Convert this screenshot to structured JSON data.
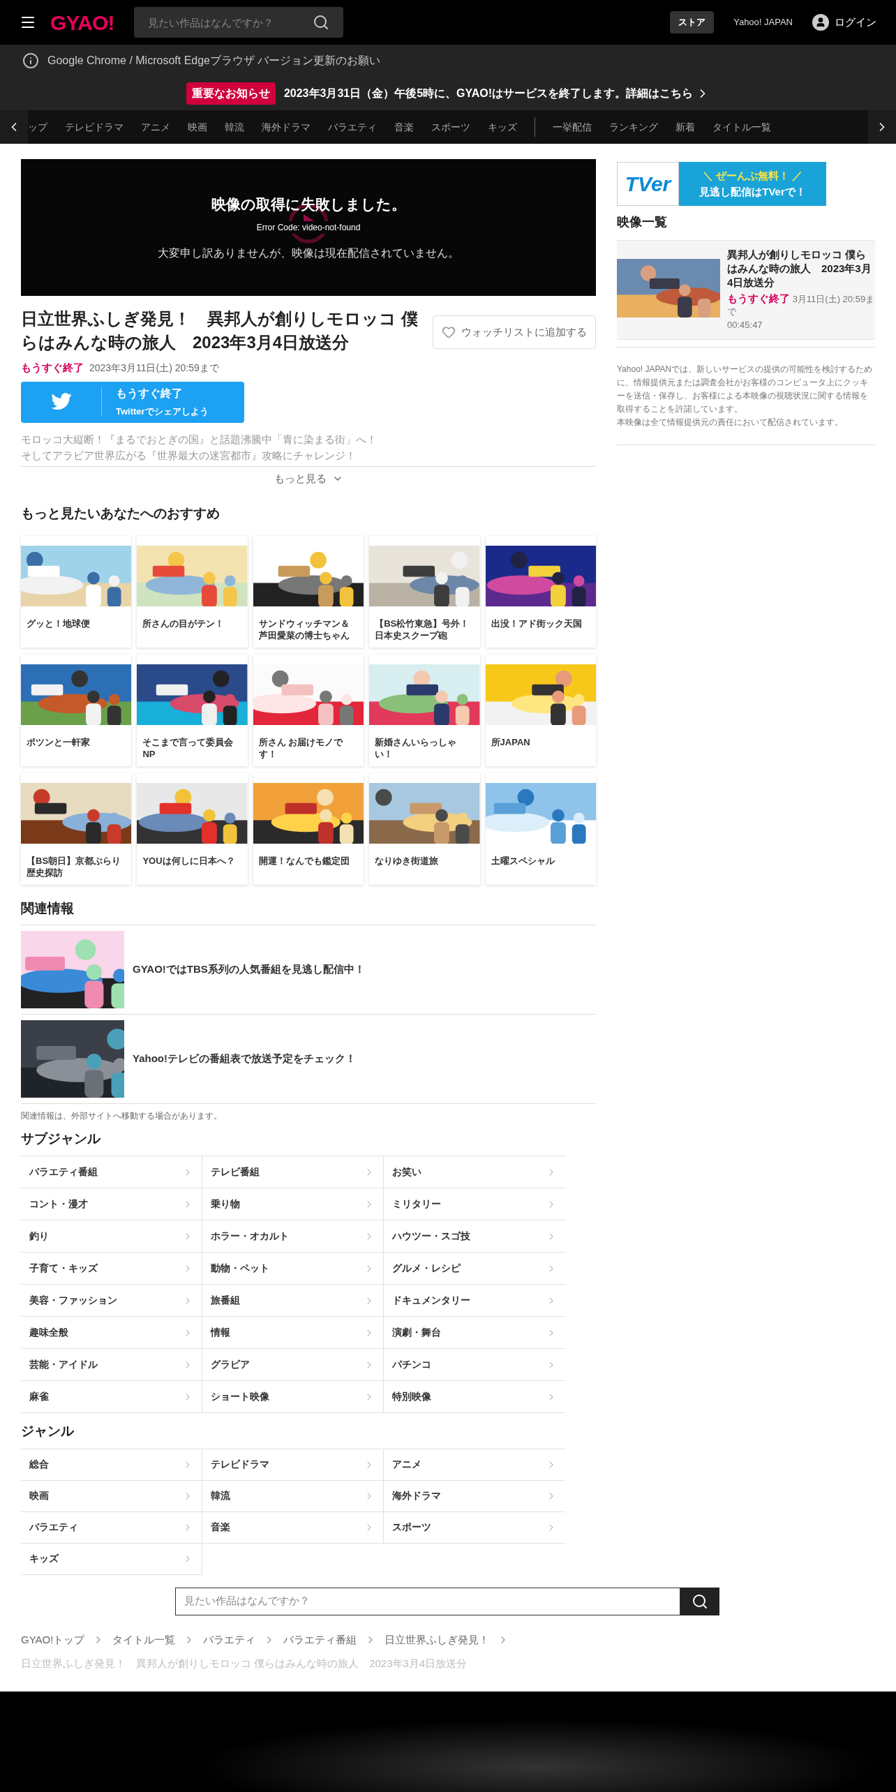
{
  "header": {
    "logo": "GYAO!",
    "search": {
      "placeholder": "見たい作品はなんですか？"
    },
    "store": "ストア",
    "yahoo": "Yahoo! JAPAN",
    "login": "ログイン"
  },
  "browser_notice": "Google Chrome / Microsoft Edgeブラウザ バージョン更新のお願い",
  "announcement": {
    "badge": "重要なお知らせ",
    "text": "2023年3月31日（金）午後5時に、GYAO!はサービスを終了します。詳細はこちら"
  },
  "nav": {
    "items": [
      "ップ",
      "テレビドラマ",
      "アニメ",
      "映画",
      "韓流",
      "海外ドラマ",
      "バラエティ",
      "音楽",
      "スポーツ",
      "キッズ"
    ],
    "extra_items": [
      "一挙配信",
      "ランキング",
      "新着",
      "タイトル一覧"
    ]
  },
  "player": {
    "error": "映像の取得に失敗しました。",
    "code": "Error Code: video-not-found",
    "message": "大変申し訳ありませんが、映像は現在配信されていません。"
  },
  "title": "日立世界ふしぎ発見！　異邦人が創りしモロッコ 僕らはみんな時の旅人　2023年3月4日放送分",
  "watchlist": "ウォッチリストに追加する",
  "status": {
    "badge": "もうすぐ終了",
    "until": "2023年3月11日(土) 20:59まで"
  },
  "twitter": {
    "line1": "もうすぐ終了",
    "line2": "Twitterでシェアしよう"
  },
  "description": [
    "モロッコ大縦断！『まるでおとぎの国』と話題沸騰中「青に染まる街」へ！",
    "そしてアラビア世界広がる『世界最大の迷宮都市』攻略にチャレンジ！"
  ],
  "more": "もっと見る",
  "recommend": {
    "heading": "もっと見たいあなたへのおすすめ",
    "items": [
      {
        "title": "グッと！地球便"
      },
      {
        "title": "所さんの目がテン！"
      },
      {
        "title": "サンドウィッチマン＆芦田愛菜の博士ちゃん"
      },
      {
        "title": "【BS松竹東急】号外！日本史スクープ砲"
      },
      {
        "title": "出没！アド街ック天国"
      },
      {
        "title": "ポツンと一軒家"
      },
      {
        "title": "そこまで言って委員会NP"
      },
      {
        "title": "所さん お届けモノです！"
      },
      {
        "title": "新婚さんいらっしゃい！"
      },
      {
        "title": "所JAPAN"
      },
      {
        "title": "【BS朝日】京都ぶらり歴史探訪"
      },
      {
        "title": "YOUは何しに日本へ？"
      },
      {
        "title": "開運！なんでも鑑定団"
      },
      {
        "title": "なりゆき街道旅"
      },
      {
        "title": "土曜スペシャル"
      }
    ]
  },
  "related": {
    "heading": "関連情報",
    "items": [
      {
        "text": "GYAO!ではTBS系列の人気番組を見逃し配信中！"
      },
      {
        "text": "Yahoo!テレビの番組表で放送予定をチェック！"
      }
    ],
    "note": "関連情報は、外部サイトへ移動する場合があります。"
  },
  "subgenres": {
    "heading": "サブジャンル",
    "items": [
      "バラエティ番組",
      "テレビ番組",
      "お笑い",
      "コント・漫才",
      "乗り物",
      "ミリタリー",
      "釣り",
      "ホラー・オカルト",
      "ハウツー・スゴ技",
      "子育て・キッズ",
      "動物・ペット",
      "グルメ・レシピ",
      "美容・ファッション",
      "旅番組",
      "ドキュメンタリー",
      "趣味全般",
      "情報",
      "演劇・舞台",
      "芸能・アイドル",
      "グラビア",
      "パチンコ",
      "麻雀",
      "ショート映像",
      "特別映像"
    ]
  },
  "genres": {
    "heading": "ジャンル",
    "items": [
      "総合",
      "テレビドラマ",
      "アニメ",
      "映画",
      "韓流",
      "海外ドラマ",
      "バラエティ",
      "音楽",
      "スポーツ",
      "キッズ"
    ]
  },
  "bottom_search": {
    "placeholder": "見たい作品はなんですか？"
  },
  "breadcrumb": [
    "GYAO!トップ",
    "タイトル一覧",
    "バラエティ",
    "バラエティ番組",
    "日立世界ふしぎ発見！"
  ],
  "current": "日立世界ふしぎ発見！　異邦人が創りしモロッコ 僕らはみんな時の旅人　2023年3月4日放送分",
  "sidebar": {
    "banner": {
      "logo": "TVer",
      "line1": "＼ ぜーんぶ無料！ ／",
      "line2": "見逃し配信はTVerで！"
    },
    "heading": "映像一覧",
    "video": {
      "title": "異邦人が創りしモロッコ 僕らはみんな時の旅人　2023年3月4日放送分",
      "badge": "もうすぐ終了",
      "until": "3月11日(土) 20:59まで",
      "duration": "00:45:47"
    },
    "disclaimer": [
      "Yahoo! JAPANでは、新しいサービスの提供の可能性を検討するために、情報提供元または調査会社がお客様のコンピュータ上にクッキーを送信・保存し、お客様による本映像の視聴状況に関する情報を取得することを許諾しています。",
      "本映像は全て情報提供元の責任において配信されています。"
    ]
  }
}
